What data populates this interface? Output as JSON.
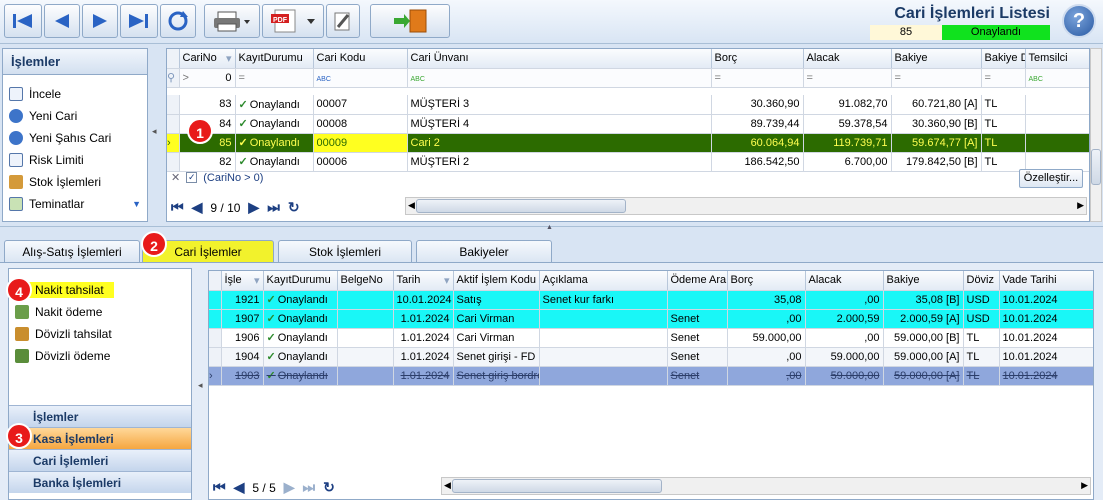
{
  "header": {
    "title": "Cari İşlemleri Listesi",
    "count": "85",
    "status": "Onaylandı",
    "help": "?"
  },
  "left_panel": {
    "title": "İşlemler",
    "items": [
      {
        "label": "İncele",
        "icon": "document-icon"
      },
      {
        "label": "Yeni Cari",
        "icon": "add-icon"
      },
      {
        "label": "Yeni Şahıs Cari",
        "icon": "add-icon"
      },
      {
        "label": "Risk Limiti",
        "icon": "document-icon"
      },
      {
        "label": "Stok İşlemleri",
        "icon": "boxes-icon"
      },
      {
        "label": "Teminatlar",
        "icon": "document-icon"
      }
    ]
  },
  "top_grid": {
    "columns": [
      "CariNo",
      "KayıtDurumu",
      "Cari Kodu",
      "Cari Ünvanı",
      "Borç",
      "Alacak",
      "Bakiye",
      "Bakiye D",
      "Temsilci"
    ],
    "filter_value": "0",
    "rows": [
      {
        "no": "83",
        "status": "Onaylandı",
        "code": "00007",
        "name": "MÜŞTERİ 3",
        "borc": "30.360,90",
        "alacak": "91.082,70",
        "bakiye": "60.721,80 [A]",
        "cur": "TL",
        "temsilci": ""
      },
      {
        "no": "84",
        "status": "Onaylandı",
        "code": "00008",
        "name": "MÜŞTERİ 4",
        "borc": "89.739,44",
        "alacak": "59.378,54",
        "bakiye": "30.360,90 [B]",
        "cur": "TL",
        "temsilci": ""
      },
      {
        "no": "85",
        "status": "Onaylandı",
        "code": "00009",
        "name": "Cari 2",
        "borc": "60.064,94",
        "alacak": "119.739,71",
        "bakiye": "59.674,77 [A]",
        "cur": "TL",
        "temsilci": ""
      },
      {
        "no": "82",
        "status": "Onaylandı",
        "code": "00006",
        "name": "MÜŞTERİ 2",
        "borc": "186.542,50",
        "alacak": "6.700,00",
        "bakiye": "179.842,50 [B]",
        "cur": "TL",
        "temsilci": ""
      }
    ],
    "filter_text": "(CariNo > 0)",
    "customize": "Özelleştir...",
    "pager": "9 / 10"
  },
  "tabs": [
    "Alış-Satış İşlemleri",
    "Cari İşlemler",
    "Stok İşlemleri",
    "Bakiyeler"
  ],
  "bottom_left": {
    "items": [
      "Nakit tahsilat",
      "Nakit ödeme",
      "Dövizli tahsilat",
      "Dövizli ödeme"
    ],
    "groups": [
      "İşlemler",
      "Kasa İşlemleri",
      "Cari İşlemleri",
      "Banka İşlemleri"
    ]
  },
  "bottom_grid": {
    "columns": [
      "İşle",
      "KayıtDurumu",
      "BelgeNo",
      "Tarih",
      "Aktif İşlem Kodu",
      "Açıklama",
      "Ödeme Araı",
      "Borç",
      "Alacak",
      "Bakiye",
      "Döviz",
      "Vade Tarihi"
    ],
    "rows": [
      {
        "no": "1921",
        "status": "Onaylandı",
        "belge": "",
        "tarih": "10.01.2024",
        "kod": "Satış",
        "aciklama": "Senet kur farkı",
        "odeme": "",
        "borc": "35,08",
        "alacak": ",00",
        "bakiye": "35,08 [B]",
        "doviz": "USD",
        "vade": "10.01.2024"
      },
      {
        "no": "1907",
        "status": "Onaylandı",
        "belge": "",
        "tarih": "1.01.2024",
        "kod": "Cari Virman",
        "aciklama": "",
        "odeme": "Senet",
        "borc": ",00",
        "alacak": "2.000,59",
        "bakiye": "2.000,59 [A]",
        "doviz": "USD",
        "vade": "10.01.2024"
      },
      {
        "no": "1906",
        "status": "Onaylandı",
        "belge": "",
        "tarih": "1.01.2024",
        "kod": "Cari Virman",
        "aciklama": "",
        "odeme": "Senet",
        "borc": "59.000,00",
        "alacak": ",00",
        "bakiye": "59.000,00 [B]",
        "doviz": "TL",
        "vade": "10.01.2024"
      },
      {
        "no": "1904",
        "status": "Onaylandı",
        "belge": "",
        "tarih": "1.01.2024",
        "kod": "Senet girişi - FD",
        "aciklama": "",
        "odeme": "Senet",
        "borc": ",00",
        "alacak": "59.000,00",
        "bakiye": "59.000,00 [A]",
        "doviz": "TL",
        "vade": "10.01.2024"
      },
      {
        "no": "1903",
        "status": "Onaylandı",
        "belge": "",
        "tarih": "1.01.2024",
        "kod": "Senet giriş bordro",
        "aciklama": "",
        "odeme": "Senet",
        "borc": ",00",
        "alacak": "59.000,00",
        "bakiye": "59.000,00 [A]",
        "doviz": "TL",
        "vade": "10.01.2024"
      }
    ],
    "pager": "5 / 5"
  },
  "badges": [
    "1",
    "2",
    "3",
    "4"
  ],
  "colors": {
    "selected_row": "#2c6b00",
    "highlight": "#ffff20",
    "cyan_row": "#19f7f7",
    "blue_row": "#8fa7dc",
    "status_green": "#10e21e"
  }
}
